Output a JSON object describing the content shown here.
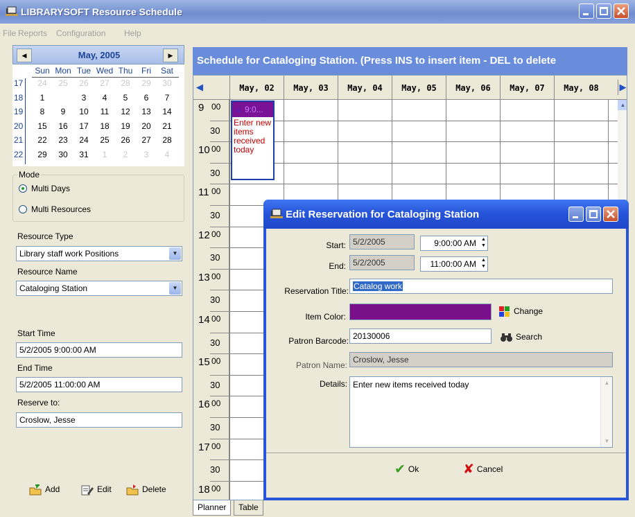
{
  "window": {
    "title": "LIBRARYSOFT Resource Schedule",
    "menu": [
      "File",
      "Reports",
      "Configuration",
      "Help"
    ]
  },
  "calendar": {
    "month_label": "May, 2005",
    "prev": "◀",
    "next": "▶",
    "dow": [
      "Sun",
      "Mon",
      "Tue",
      "Wed",
      "Thu",
      "Fri",
      "Sat"
    ],
    "weeks": [
      {
        "num": "17",
        "days": [
          "24",
          "25",
          "26",
          "27",
          "28",
          "29",
          "30"
        ],
        "other": [
          true,
          true,
          true,
          true,
          true,
          true,
          true
        ]
      },
      {
        "num": "18",
        "days": [
          "1",
          "2",
          "3",
          "4",
          "5",
          "6",
          "7"
        ],
        "other": [
          false,
          false,
          false,
          false,
          false,
          false,
          false
        ]
      },
      {
        "num": "19",
        "days": [
          "8",
          "9",
          "10",
          "11",
          "12",
          "13",
          "14"
        ],
        "other": [
          false,
          false,
          false,
          false,
          false,
          false,
          false
        ]
      },
      {
        "num": "20",
        "days": [
          "15",
          "16",
          "17",
          "18",
          "19",
          "20",
          "21"
        ],
        "other": [
          false,
          false,
          false,
          false,
          false,
          false,
          false
        ]
      },
      {
        "num": "21",
        "days": [
          "22",
          "23",
          "24",
          "25",
          "26",
          "27",
          "28"
        ],
        "other": [
          false,
          false,
          false,
          false,
          false,
          false,
          false
        ]
      },
      {
        "num": "22",
        "days": [
          "29",
          "30",
          "31",
          "1",
          "2",
          "3",
          "4"
        ],
        "other": [
          false,
          false,
          false,
          true,
          true,
          true,
          true
        ]
      }
    ],
    "selected_day": "2"
  },
  "mode": {
    "label": "Mode",
    "options": [
      {
        "label": "Multi Days",
        "checked": true
      },
      {
        "label": "Multi Resources",
        "checked": false
      }
    ]
  },
  "resource": {
    "type_label": "Resource Type",
    "type_value": "Library staff work Positions",
    "name_label": "Resource Name",
    "name_value": "Cataloging Station"
  },
  "reservation_info": {
    "start_label": "Start Time",
    "start_value": "5/2/2005 9:00:00 AM",
    "end_label": "End Time",
    "end_value": "5/2/2005 11:00:00 AM",
    "reserve_label": "Reserve to:",
    "reserve_value": "Croslow, Jesse"
  },
  "left_buttons": {
    "add": "Add",
    "edit": "Edit",
    "delete": "Delete"
  },
  "schedule": {
    "title": "Schedule for Cataloging Station. (Press INS to insert item - DEL to delete",
    "days": [
      "May, 02",
      "May, 03",
      "May, 04",
      "May, 05",
      "May, 06",
      "May, 07",
      "May, 08"
    ],
    "times": [
      {
        "h": "9",
        "m": "00"
      },
      {
        "h": "",
        "m": "30"
      },
      {
        "h": "10",
        "m": "00"
      },
      {
        "h": "",
        "m": "30"
      },
      {
        "h": "11",
        "m": "00"
      },
      {
        "h": "",
        "m": "30"
      },
      {
        "h": "12",
        "m": "00"
      },
      {
        "h": "",
        "m": "30"
      },
      {
        "h": "13",
        "m": "00"
      },
      {
        "h": "",
        "m": "30"
      },
      {
        "h": "14",
        "m": "00"
      },
      {
        "h": "",
        "m": "30"
      },
      {
        "h": "15",
        "m": "00"
      },
      {
        "h": "",
        "m": "30"
      },
      {
        "h": "16",
        "m": "00"
      },
      {
        "h": "",
        "m": "30"
      },
      {
        "h": "17",
        "m": "00"
      },
      {
        "h": "",
        "m": "30"
      },
      {
        "h": "18",
        "m": "00"
      }
    ],
    "event": {
      "time": "9:0...",
      "text": "Enter new items received today",
      "color": "#7a1296"
    },
    "tabs": [
      "Planner",
      "Table"
    ]
  },
  "dialog": {
    "title": "Edit Reservation for Cataloging Station",
    "start_label": "Start:",
    "start_date": "5/2/2005",
    "start_time": "9:00:00 AM",
    "end_label": "End:",
    "end_date": "5/2/2005",
    "end_time": "11:00:00 AM",
    "title_label": "Reservation Title:",
    "title_value": "Catalog work",
    "color_label": "Item Color:",
    "color_value": "#7a0f8a",
    "change_label": "Change",
    "barcode_label": "Patron Barcode:",
    "barcode_value": "20130006",
    "search_label": "Search",
    "patron_label": "Patron Name:",
    "patron_value": "Croslow, Jesse",
    "details_label": "Details:",
    "details_value": "Enter new items received today",
    "ok_label": "Ok",
    "cancel_label": "Cancel"
  }
}
